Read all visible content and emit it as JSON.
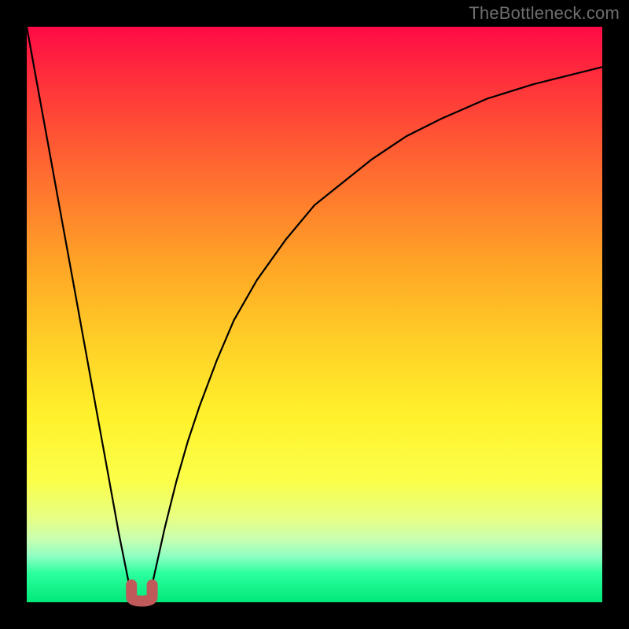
{
  "watermark": "TheBottleneck.com",
  "colors": {
    "frame": "#000000",
    "curve": "#000000",
    "marker": "#c05a5a",
    "gradient_top": "#ff0a46",
    "gradient_bottom": "#00e879"
  },
  "chart_data": {
    "type": "line",
    "title": "",
    "xlabel": "",
    "ylabel": "",
    "xlim": [
      0,
      100
    ],
    "ylim": [
      0,
      100
    ],
    "series": [
      {
        "name": "bottleneck-curve",
        "x": [
          0,
          2,
          4,
          6,
          8,
          10,
          12,
          14,
          16,
          18,
          18.5,
          19,
          19.5,
          20,
          20.5,
          21,
          21.5,
          22,
          24,
          26,
          28,
          30,
          33,
          36,
          40,
          45,
          50,
          55,
          60,
          66,
          72,
          80,
          88,
          94,
          100
        ],
        "values": [
          100,
          89,
          78,
          67,
          56,
          45,
          34,
          23,
          12,
          2,
          1,
          0.5,
          0.3,
          0.3,
          0.5,
          1,
          2,
          4,
          13,
          21,
          28,
          34,
          42,
          49,
          56,
          63,
          69,
          73,
          77,
          81,
          84,
          87.5,
          90,
          91.5,
          93
        ]
      }
    ],
    "marker": {
      "name": "optimal-range",
      "shape": "U",
      "x_range": [
        18.2,
        21.8
      ],
      "y_range": [
        0.2,
        3.0
      ]
    },
    "gradient_meaning": "red = high bottleneck, green = low bottleneck"
  }
}
